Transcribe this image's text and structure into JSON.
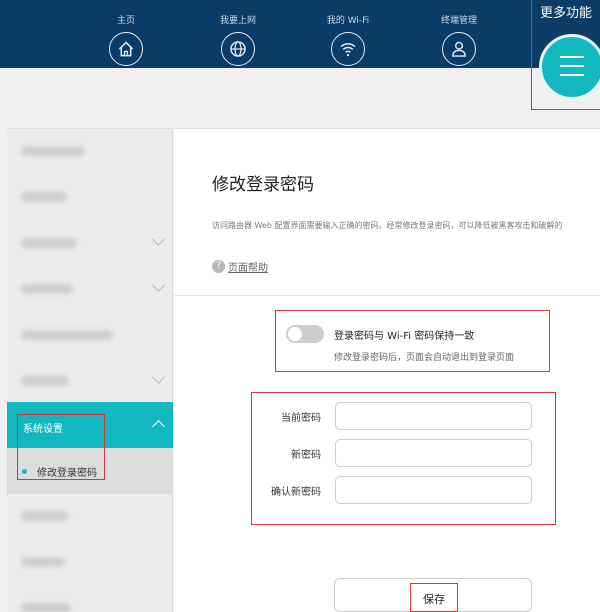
{
  "nav": {
    "items": [
      {
        "label": "主页",
        "icon": "home-icon"
      },
      {
        "label": "我要上网",
        "icon": "globe-icon"
      },
      {
        "label": "我的 Wi-Fi",
        "icon": "wifi-icon"
      },
      {
        "label": "终端管理",
        "icon": "user-icon"
      }
    ],
    "more_label": "更多功能"
  },
  "sidebar": {
    "active_section": "系统设置",
    "active_item": "修改登录密码"
  },
  "main": {
    "title": "修改登录密码",
    "description": "访问路由器 Web 配置界面需要输入正确的密码。经常修改登录密码，可以降低被黑客攻击和破解的",
    "help_link": "页面帮助",
    "toggle_label": "登录密码与 Wi-Fi 密码保持一致",
    "toggle_hint": "修改登录密码后，页面会自动退出到登录页面",
    "toggle_on": false,
    "fields": [
      {
        "label": "当前密码",
        "value": ""
      },
      {
        "label": "新密码",
        "value": ""
      },
      {
        "label": "确认新密码",
        "value": ""
      }
    ],
    "save_label": "保存"
  },
  "colors": {
    "topbar": "#0b3c67",
    "accent": "#12b7bf",
    "highlight": "#d33333"
  }
}
